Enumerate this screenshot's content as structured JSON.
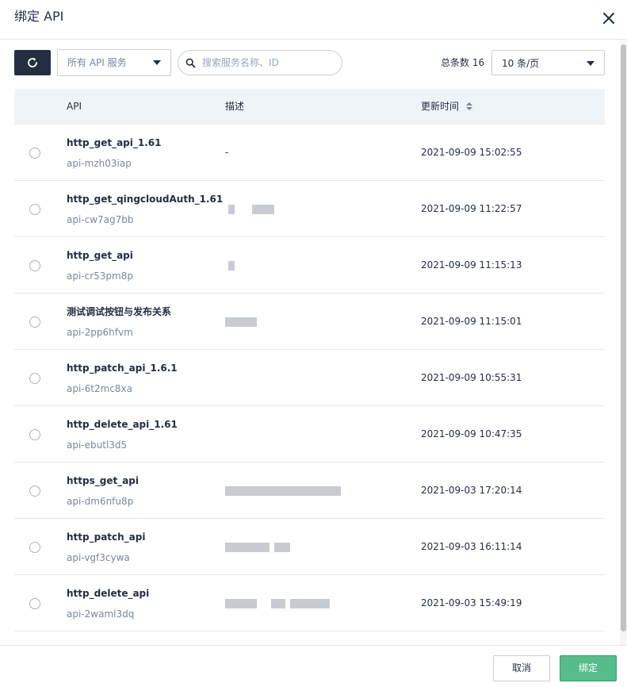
{
  "dialog": {
    "title": "绑定 API",
    "close_icon": "close-icon"
  },
  "toolbar": {
    "refresh_icon": "refresh-icon",
    "service_select": "所有 API 服务",
    "search_placeholder": "搜索服务名称、ID",
    "search_value": "",
    "total_label": "总条数 16",
    "page_size": "10 条/页"
  },
  "table": {
    "columns": {
      "api": "API",
      "desc": "描述",
      "time": "更新时间"
    },
    "sort_icon": "sort-icon",
    "rows": [
      {
        "name": "http_get_api_1.61",
        "id": "api-mzh03iap",
        "desc": "-",
        "time": "2021-09-09 15:02:55"
      },
      {
        "name": "http_get_qingcloudAuth_1.61",
        "id": "api-cw7ag7bb",
        "desc": "",
        "time": "2021-09-09 11:22:57"
      },
      {
        "name": "http_get_api",
        "id": "api-cr53pm8p",
        "desc": "",
        "time": "2021-09-09 11:15:13"
      },
      {
        "name": "测试调试按钮与发布关系",
        "id": "api-2pp6hfvm",
        "desc": "",
        "time": "2021-09-09 11:15:01"
      },
      {
        "name": "http_patch_api_1.6.1",
        "id": "api-6t2mc8xa",
        "desc": "",
        "time": "2021-09-09 10:55:31"
      },
      {
        "name": "http_delete_api_1.61",
        "id": "api-ebutl3d5",
        "desc": "",
        "time": "2021-09-09 10:47:35"
      },
      {
        "name": "https_get_api",
        "id": "api-dm6nfu8p",
        "desc": "",
        "time": "2021-09-03 17:20:14"
      },
      {
        "name": "http_patch_api",
        "id": "api-vgf3cywa",
        "desc": "",
        "time": "2021-09-03 16:11:14"
      },
      {
        "name": "http_delete_api",
        "id": "api-2waml3dq",
        "desc": "",
        "time": "2021-09-03 15:49:19"
      }
    ]
  },
  "footer": {
    "cancel_label": "取消",
    "bind_label": "绑定"
  },
  "colors": {
    "primary_dark": "#242e42",
    "accent_green": "#55bc8a",
    "header_bg": "#eff4f9",
    "border": "#e3e9ef"
  }
}
